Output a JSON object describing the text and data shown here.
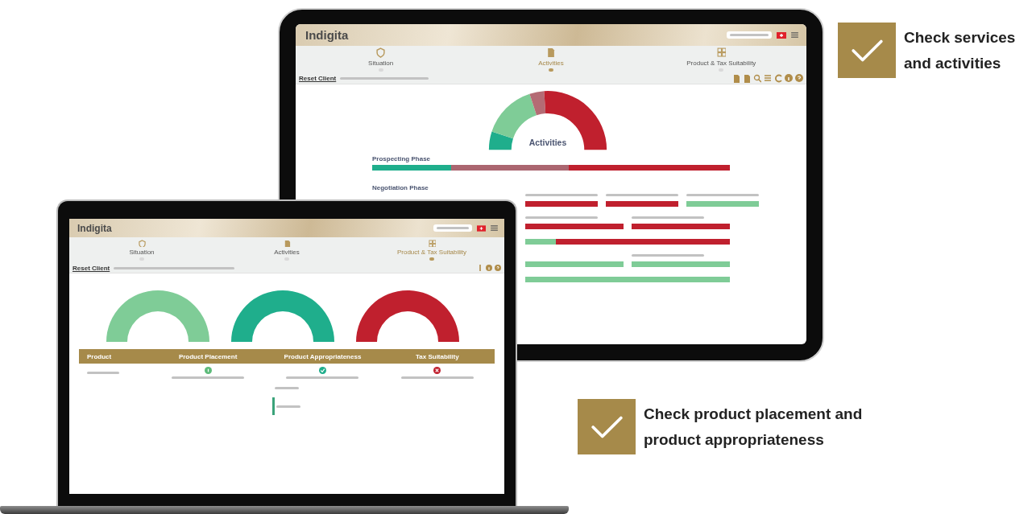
{
  "tablet": {
    "logo": "Indigita",
    "tabs": [
      {
        "label": "Situation",
        "selected": false
      },
      {
        "label": "Activities",
        "selected": true
      },
      {
        "label": "Product & Tax Suitability",
        "selected": false
      }
    ],
    "reset_label": "Reset Client",
    "gauge": {
      "label": "Activities"
    },
    "phases": [
      {
        "title": "Prospecting Phase",
        "rows": [
          [
            {
              "kind": "plain",
              "segments": [
                {
                  "color": "#1fae8c",
                  "level": 0.22
                },
                {
                  "color": "#ab6670",
                  "level": 0.33
                },
                {
                  "color": "#c0202e",
                  "level": 0.45
                }
              ]
            }
          ]
        ]
      },
      {
        "title": "Negotiation Phase",
        "rows": [
          [
            {
              "kind": "labeled",
              "segments": [
                {
                  "color": "#c0202e",
                  "level": 1
                }
              ]
            },
            {
              "kind": "labeled",
              "segments": [
                {
                  "color": "#c0202e",
                  "level": 1
                }
              ]
            },
            {
              "kind": "labeled",
              "segments": [
                {
                  "color": "#7fcc97",
                  "level": 1
                }
              ]
            }
          ],
          [
            {
              "kind": "labeled",
              "segments": [
                {
                  "color": "#c0202e",
                  "level": 1
                }
              ]
            },
            {
              "kind": "labeled",
              "segments": [
                {
                  "color": "#c0202e",
                  "level": 1
                }
              ]
            }
          ],
          [
            {
              "kind": "plain",
              "segments": [
                {
                  "color": "#7fcc97",
                  "level": 0.15
                },
                {
                  "color": "#c0202e",
                  "level": 0.85
                }
              ]
            }
          ],
          [
            {
              "kind": "plain",
              "segments": [
                {
                  "color": "#7fcc97",
                  "level": 1
                }
              ]
            },
            {
              "kind": "labeled",
              "segments": [
                {
                  "color": "#7fcc97",
                  "level": 1
                }
              ]
            }
          ],
          [
            {
              "kind": "plain",
              "segments": [
                {
                  "color": "#7fcc97",
                  "level": 1
                }
              ]
            }
          ]
        ]
      }
    ]
  },
  "laptop": {
    "logo": "Indigita",
    "tabs": [
      {
        "label": "Situation",
        "selected": false
      },
      {
        "label": "Activities",
        "selected": false
      },
      {
        "label": "Product & Tax Suitability",
        "selected": true
      }
    ],
    "reset_label": "Reset Client",
    "gauges": [
      {
        "color": "#7fcc97"
      },
      {
        "color": "#1fae8c"
      },
      {
        "color": "#c0202e"
      }
    ],
    "table": {
      "columns": [
        "Product",
        "Product Placement",
        "Product Appropriateness",
        "Tax Suitability"
      ],
      "statuses": [
        {
          "kind": "info"
        },
        {
          "kind": "ok"
        },
        {
          "kind": "fail"
        }
      ]
    }
  },
  "callouts": [
    {
      "text": "Check services and activities"
    },
    {
      "text": "Check product placement and product appropriateness"
    }
  ]
}
